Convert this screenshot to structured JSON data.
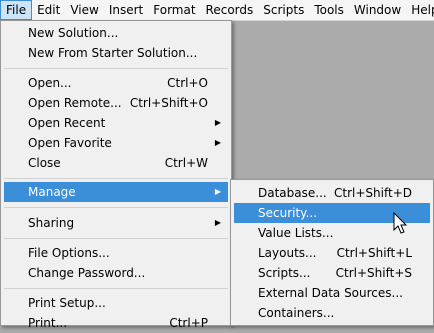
{
  "menubar": [
    "File",
    "Edit",
    "View",
    "Insert",
    "Format",
    "Records",
    "Scripts",
    "Tools",
    "Window",
    "Help"
  ],
  "file_menu": {
    "new_solution": "New Solution...",
    "new_from_starter": "New From Starter Solution...",
    "open": "Open...",
    "open_sc": "Ctrl+O",
    "open_remote": "Open Remote...",
    "open_remote_sc": "Ctrl+Shift+O",
    "open_recent": "Open Recent",
    "open_favorite": "Open Favorite",
    "close": "Close",
    "close_sc": "Ctrl+W",
    "manage": "Manage",
    "sharing": "Sharing",
    "file_options": "File Options...",
    "change_password": "Change Password...",
    "print_setup": "Print Setup...",
    "print": "Print...",
    "print_sc": "Ctrl+P"
  },
  "manage_menu": {
    "database": "Database...",
    "database_sc": "Ctrl+Shift+D",
    "security": "Security...",
    "value_lists": "Value Lists...",
    "layouts": "Layouts...",
    "layouts_sc": "Ctrl+Shift+L",
    "scripts": "Scripts...",
    "scripts_sc": "Ctrl+Shift+S",
    "external_data_sources": "External Data Sources...",
    "containers": "Containers..."
  },
  "colors": {
    "highlight": "#3b8fd9",
    "menu_bg": "#f0f0f0",
    "backdrop": "#ababab"
  }
}
